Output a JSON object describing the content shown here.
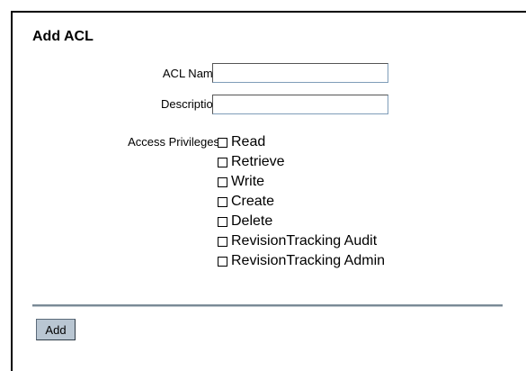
{
  "form": {
    "title": "Add ACL",
    "acl_name_label": "ACL Name",
    "acl_name_value": "",
    "description_label": "Description",
    "description_value": "",
    "privileges_label": "Access Privileges",
    "privileges": [
      {
        "label": "Read",
        "checked": false
      },
      {
        "label": "Retrieve",
        "checked": false
      },
      {
        "label": "Write",
        "checked": false
      },
      {
        "label": "Create",
        "checked": false
      },
      {
        "label": "Delete",
        "checked": false
      },
      {
        "label": "RevisionTracking Audit",
        "checked": false
      },
      {
        "label": "RevisionTracking Admin",
        "checked": false
      }
    ],
    "add_label": "Add"
  }
}
